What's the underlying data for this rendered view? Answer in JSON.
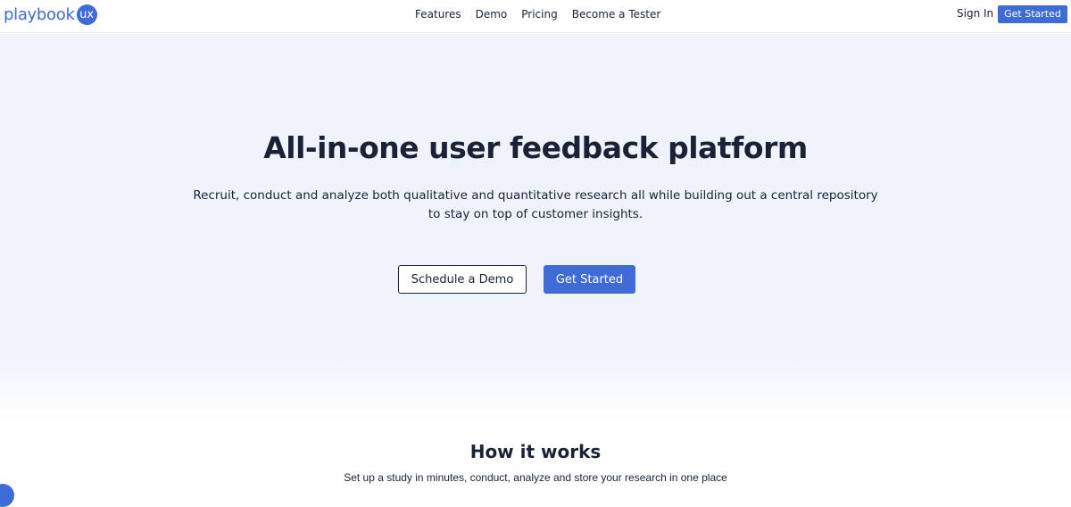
{
  "header": {
    "logo": {
      "word": "playbook",
      "badge": "ux"
    },
    "nav": [
      {
        "label": "Features"
      },
      {
        "label": "Demo"
      },
      {
        "label": "Pricing"
      },
      {
        "label": "Become a Tester"
      }
    ],
    "sign_in_label": "Sign In",
    "cta_label": "Get Started"
  },
  "hero": {
    "title": "All-in-one user feedback platform",
    "subtitle": "Recruit, conduct and analyze both qualitative and quantitative research all while building out a central repository to stay on top of customer insights.",
    "demo_button_label": "Schedule a Demo",
    "start_button_label": "Get Started"
  },
  "how_it_works": {
    "title": "How it works",
    "subtitle": "Set up a study in minutes, conduct, analyze and store your research in one place"
  },
  "colors": {
    "brand": "#3f6bd6",
    "text": "#1b2235",
    "hero_bg": "#eff3fc"
  },
  "icons": {
    "chat": "chat-bubble-icon"
  }
}
